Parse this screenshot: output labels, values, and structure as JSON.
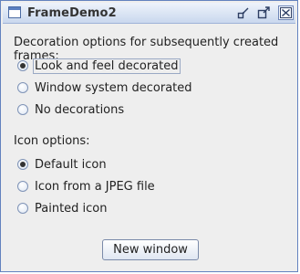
{
  "window": {
    "title": "FrameDemo2",
    "controls": [
      "restore-icon",
      "maximize-icon",
      "close-icon"
    ]
  },
  "decoration": {
    "heading": "Decoration options for subsequently created frames:",
    "options": [
      {
        "label": "Look and feel decorated",
        "selected": true
      },
      {
        "label": "Window system decorated",
        "selected": false
      },
      {
        "label": "No decorations",
        "selected": false
      }
    ]
  },
  "icon": {
    "heading": "Icon options:",
    "options": [
      {
        "label": "Default icon",
        "selected": true
      },
      {
        "label": "Icon from a JPEG file",
        "selected": false
      },
      {
        "label": "Painted icon",
        "selected": false
      }
    ]
  },
  "actions": {
    "new_window_label": "New window"
  }
}
